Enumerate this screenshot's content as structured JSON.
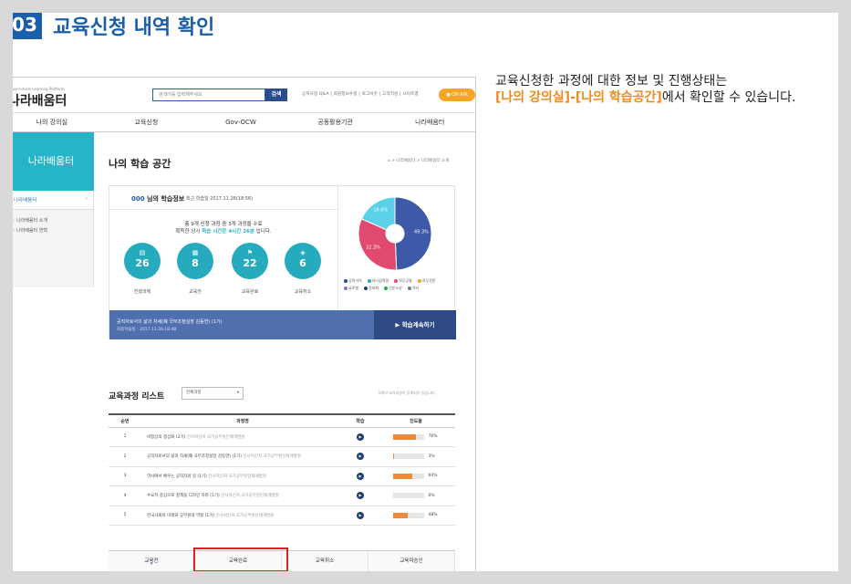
{
  "step": {
    "number": "03",
    "title": "교육신청 내역 확인"
  },
  "description": {
    "line1": "교육신청한 과정에 대한 정보 및 진행상태는",
    "highlight": "[나의 강의실]-[나의 학습공간]",
    "line2_rest": "에서 확인할 수 있습니다."
  },
  "site": {
    "logo_small": "Government Learning Platform",
    "logo": "나라배움터",
    "search_placeholder": "검색어를 입력해주세요",
    "search_button": "검색",
    "top_links": "공지사항 Q&A | 회원정보수정 | 로그아웃 | 고객지원 | 사이트맵",
    "onair": "ON AIR",
    "gnb": [
      "나의 강의실",
      "교육신청",
      "Gov-OCW",
      "공동활용기관",
      "나라배움터"
    ],
    "lnb_title": "나라배움터",
    "lnb_item": "나라배움터",
    "lnb_subs": [
      "· 나라배움터 소개",
      "· 나라배움터 연혁"
    ]
  },
  "page": {
    "title": "나의 학습 공간",
    "breadcrumb": "⌂ > 나라배움터 > 나라배움터 소개"
  },
  "info": {
    "name_prefix": "000",
    "name_suffix": " 님의 학습정보",
    "last_study": "최근 학습일 2017.11.26(18:56)",
    "summary1": "총 9개 신청 과정 중 3개 과정을 수료",
    "summary2_pre": "획득한 상시 ",
    "summary2_hl": "학습 시간은 4시간 26분",
    "summary2_post": " 입니다.",
    "stats": [
      {
        "icon": "▤",
        "value": "26",
        "label": "진행과제"
      },
      {
        "icon": "▦",
        "value": "8",
        "label": "교육전"
      },
      {
        "icon": "⚑",
        "value": "22",
        "label": "교육완료"
      },
      {
        "icon": "◈",
        "value": "6",
        "label": "교육취소"
      }
    ],
    "legend": [
      {
        "label": "공직가치",
        "color": "#2a4c9c"
      },
      {
        "label": "리더십역량",
        "color": "#26aabd"
      },
      {
        "label": "직무공통",
        "color": "#e04a6e"
      },
      {
        "label": "직무전문",
        "color": "#f5a623"
      },
      {
        "label": "글로벌",
        "color": "#8a6fc8"
      },
      {
        "label": "정보화",
        "color": "#1f3f77"
      },
      {
        "label": "인문소양",
        "color": "#2aa84a"
      },
      {
        "label": "기타",
        "color": "#777777"
      }
    ],
    "resume_title": "공직자로서의 삶과 자세(폐 국무조정실장 김동연) (1기)",
    "resume_date": "최종학습일 : 2017.11.26.18:48",
    "resume_button": "학습계속하기"
  },
  "chart_data": {
    "type": "pie",
    "slices": [
      {
        "label": "",
        "value": 49.3,
        "color": "#3d5aa8"
      },
      {
        "label": "",
        "value": 32.3,
        "color": "#e04a6e"
      },
      {
        "label": "",
        "value": 18.4,
        "color": "#5ad1e6"
      }
    ],
    "labels_text": [
      "49.3%",
      "32.3%",
      "18.4%"
    ]
  },
  "list": {
    "title": "교육과정 리스트",
    "select": "전체과정",
    "note": "5개의 교육과정이 등록되어 있습니다.",
    "headers": [
      "순번",
      "과정명",
      "학습",
      "진도율"
    ],
    "rows": [
      {
        "no": "1",
        "title": "비정상의 정상화 (2기)",
        "org": "인사혁신처 국가공무원인재개발원",
        "progress": 76,
        "pct": "76%"
      },
      {
        "no": "2",
        "title": "공직자로서의 삶과 자세(폐 국무조정실장 김동연) (1기)",
        "org": "인사혁신처 국가공무원인재개발원",
        "progress": 3,
        "pct": "3%"
      },
      {
        "no": "3",
        "title": "역사에서 배우는 공직자의 길 (1기)",
        "org": "인사혁신처 국가공무원인재개발원",
        "progress": 64,
        "pct": "64%"
      },
      {
        "no": "4",
        "title": "수요자 중심으로 정책을 디자인 하라 (1기)",
        "org": "인사혁신처 국가공무원인재개발원",
        "progress": 0,
        "pct": "0%"
      },
      {
        "no": "5",
        "title": "한국사회의 미래와 공무원의 역할 (1기)",
        "org": "인사혁신처 국가공무원인재개발원",
        "progress": 48,
        "pct": "48%"
      }
    ]
  },
  "tabs": [
    "교육전",
    "교육완료",
    "교육취소",
    "교육미승인"
  ]
}
